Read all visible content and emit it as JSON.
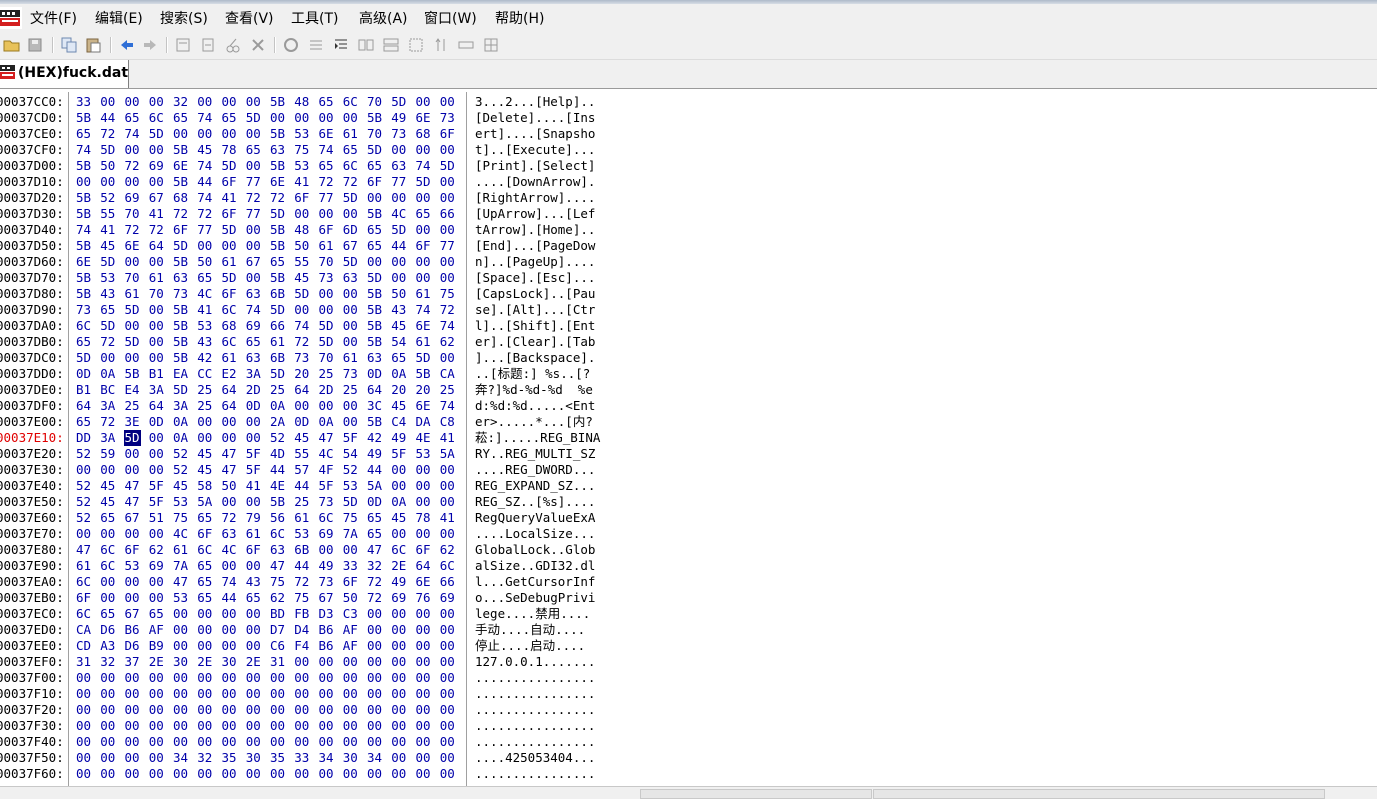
{
  "window": {
    "menu": [
      "文件(F)",
      "编辑(E)",
      "搜索(S)",
      "查看(V)",
      "工具(T)",
      "高级(A)",
      "窗口(W)",
      "帮助(H)"
    ]
  },
  "toolbar": {
    "buttons": [
      "open-icon",
      "save-icon",
      "copy-icon",
      "paste-icon",
      "back-icon",
      "forward-icon",
      "edit-icon",
      "insert-icon",
      "cut-icon",
      "delete-icon",
      "bookmark-icon",
      "list-icon",
      "indent-icon",
      "columns-icon",
      "rows-icon",
      "grid-icon",
      "sort-icon",
      "bar-icon",
      "table-icon"
    ]
  },
  "tab": {
    "title": "(HEX)fuck.dat"
  },
  "hex": {
    "current_address": "00037E10:",
    "selected_byte": "5D",
    "rows": [
      {
        "addr": "00037CC0:",
        "hex": "33 00 00 00 32 00 00 00 5B 48 65 6C 70 5D 00 00",
        "ascii": "3...2...[Help].."
      },
      {
        "addr": "00037CD0:",
        "hex": "5B 44 65 6C 65 74 65 5D 00 00 00 00 5B 49 6E 73",
        "ascii": "[Delete]....[Ins"
      },
      {
        "addr": "00037CE0:",
        "hex": "65 72 74 5D 00 00 00 00 5B 53 6E 61 70 73 68 6F",
        "ascii": "ert]....[Snapsho"
      },
      {
        "addr": "00037CF0:",
        "hex": "74 5D 00 00 5B 45 78 65 63 75 74 65 5D 00 00 00",
        "ascii": "t]..[Execute]..."
      },
      {
        "addr": "00037D00:",
        "hex": "5B 50 72 69 6E 74 5D 00 5B 53 65 6C 65 63 74 5D",
        "ascii": "[Print].[Select]"
      },
      {
        "addr": "00037D10:",
        "hex": "00 00 00 00 5B 44 6F 77 6E 41 72 72 6F 77 5D 00",
        "ascii": "....[DownArrow]."
      },
      {
        "addr": "00037D20:",
        "hex": "5B 52 69 67 68 74 41 72 72 6F 77 5D 00 00 00 00",
        "ascii": "[RightArrow]...."
      },
      {
        "addr": "00037D30:",
        "hex": "5B 55 70 41 72 72 6F 77 5D 00 00 00 5B 4C 65 66",
        "ascii": "[UpArrow]...[Lef"
      },
      {
        "addr": "00037D40:",
        "hex": "74 41 72 72 6F 77 5D 00 5B 48 6F 6D 65 5D 00 00",
        "ascii": "tArrow].[Home].."
      },
      {
        "addr": "00037D50:",
        "hex": "5B 45 6E 64 5D 00 00 00 5B 50 61 67 65 44 6F 77",
        "ascii": "[End]...[PageDow"
      },
      {
        "addr": "00037D60:",
        "hex": "6E 5D 00 00 5B 50 61 67 65 55 70 5D 00 00 00 00",
        "ascii": "n]..[PageUp]...."
      },
      {
        "addr": "00037D70:",
        "hex": "5B 53 70 61 63 65 5D 00 5B 45 73 63 5D 00 00 00",
        "ascii": "[Space].[Esc]..."
      },
      {
        "addr": "00037D80:",
        "hex": "5B 43 61 70 73 4C 6F 63 6B 5D 00 00 5B 50 61 75",
        "ascii": "[CapsLock]..[Pau"
      },
      {
        "addr": "00037D90:",
        "hex": "73 65 5D 00 5B 41 6C 74 5D 00 00 00 5B 43 74 72",
        "ascii": "se].[Alt]...[Ctr"
      },
      {
        "addr": "00037DA0:",
        "hex": "6C 5D 00 00 5B 53 68 69 66 74 5D 00 5B 45 6E 74",
        "ascii": "l]..[Shift].[Ent"
      },
      {
        "addr": "00037DB0:",
        "hex": "65 72 5D 00 5B 43 6C 65 61 72 5D 00 5B 54 61 62",
        "ascii": "er].[Clear].[Tab"
      },
      {
        "addr": "00037DC0:",
        "hex": "5D 00 00 00 5B 42 61 63 6B 73 70 61 63 65 5D 00",
        "ascii": "]...[Backspace]."
      },
      {
        "addr": "00037DD0:",
        "hex": "0D 0A 5B B1 EA CC E2 3A 5D 20 25 73 0D 0A 5B CA",
        "ascii": "..[标题:] %s..[?"
      },
      {
        "addr": "00037DE0:",
        "hex": "B1 BC E4 3A 5D 25 64 2D 25 64 2D 25 64 20 20 25",
        "ascii": "奔?]%d-%d-%d  %e"
      },
      {
        "addr": "00037DF0:",
        "hex": "64 3A 25 64 3A 25 64 0D 0A 00 00 00 3C 45 6E 74",
        "ascii": "d:%d:%d.....<Ent"
      },
      {
        "addr": "00037E00:",
        "hex": "65 72 3E 0D 0A 00 00 00 2A 0D 0A 00 5B C4 DA C8",
        "ascii": "er>.....*...[内?"
      },
      {
        "addr": "00037E10:",
        "hex": "DD 3A 5D 00 0A 00 00 00 52 45 47 5F 42 49 4E 41",
        "ascii": "菘:].....REG_BINA"
      },
      {
        "addr": "00037E20:",
        "hex": "52 59 00 00 52 45 47 5F 4D 55 4C 54 49 5F 53 5A",
        "ascii": "RY..REG_MULTI_SZ"
      },
      {
        "addr": "00037E30:",
        "hex": "00 00 00 00 52 45 47 5F 44 57 4F 52 44 00 00 00",
        "ascii": "....REG_DWORD..."
      },
      {
        "addr": "00037E40:",
        "hex": "52 45 47 5F 45 58 50 41 4E 44 5F 53 5A 00 00 00",
        "ascii": "REG_EXPAND_SZ..."
      },
      {
        "addr": "00037E50:",
        "hex": "52 45 47 5F 53 5A 00 00 5B 25 73 5D 0D 0A 00 00",
        "ascii": "REG_SZ..[%s]...."
      },
      {
        "addr": "00037E60:",
        "hex": "52 65 67 51 75 65 72 79 56 61 6C 75 65 45 78 41",
        "ascii": "RegQueryValueExA"
      },
      {
        "addr": "00037E70:",
        "hex": "00 00 00 00 4C 6F 63 61 6C 53 69 7A 65 00 00 00",
        "ascii": "....LocalSize..."
      },
      {
        "addr": "00037E80:",
        "hex": "47 6C 6F 62 61 6C 4C 6F 63 6B 00 00 47 6C 6F 62",
        "ascii": "GlobalLock..Glob"
      },
      {
        "addr": "00037E90:",
        "hex": "61 6C 53 69 7A 65 00 00 47 44 49 33 32 2E 64 6C",
        "ascii": "alSize..GDI32.dl"
      },
      {
        "addr": "00037EA0:",
        "hex": "6C 00 00 00 47 65 74 43 75 72 73 6F 72 49 6E 66",
        "ascii": "l...GetCursorInf"
      },
      {
        "addr": "00037EB0:",
        "hex": "6F 00 00 00 53 65 44 65 62 75 67 50 72 69 76 69",
        "ascii": "o...SeDebugPrivi"
      },
      {
        "addr": "00037EC0:",
        "hex": "6C 65 67 65 00 00 00 00 BD FB D3 C3 00 00 00 00",
        "ascii": "lege....禁用...."
      },
      {
        "addr": "00037ED0:",
        "hex": "CA D6 B6 AF 00 00 00 00 D7 D4 B6 AF 00 00 00 00",
        "ascii": "手动....自动...."
      },
      {
        "addr": "00037EE0:",
        "hex": "CD A3 D6 B9 00 00 00 00 C6 F4 B6 AF 00 00 00 00",
        "ascii": "停止....启动...."
      },
      {
        "addr": "00037EF0:",
        "hex": "31 32 37 2E 30 2E 30 2E 31 00 00 00 00 00 00 00",
        "ascii": "127.0.0.1......."
      },
      {
        "addr": "00037F00:",
        "hex": "00 00 00 00 00 00 00 00 00 00 00 00 00 00 00 00",
        "ascii": "................"
      },
      {
        "addr": "00037F10:",
        "hex": "00 00 00 00 00 00 00 00 00 00 00 00 00 00 00 00",
        "ascii": "................"
      },
      {
        "addr": "00037F20:",
        "hex": "00 00 00 00 00 00 00 00 00 00 00 00 00 00 00 00",
        "ascii": "................"
      },
      {
        "addr": "00037F30:",
        "hex": "00 00 00 00 00 00 00 00 00 00 00 00 00 00 00 00",
        "ascii": "................"
      },
      {
        "addr": "00037F40:",
        "hex": "00 00 00 00 00 00 00 00 00 00 00 00 00 00 00 00",
        "ascii": "................"
      },
      {
        "addr": "00037F50:",
        "hex": "00 00 00 00 34 32 35 30 35 33 34 30 34 00 00 00",
        "ascii": "....425053404..."
      },
      {
        "addr": "00037F60:",
        "hex": "00 00 00 00 00 00 00 00 00 00 00 00 00 00 00 00",
        "ascii": "................"
      }
    ]
  }
}
